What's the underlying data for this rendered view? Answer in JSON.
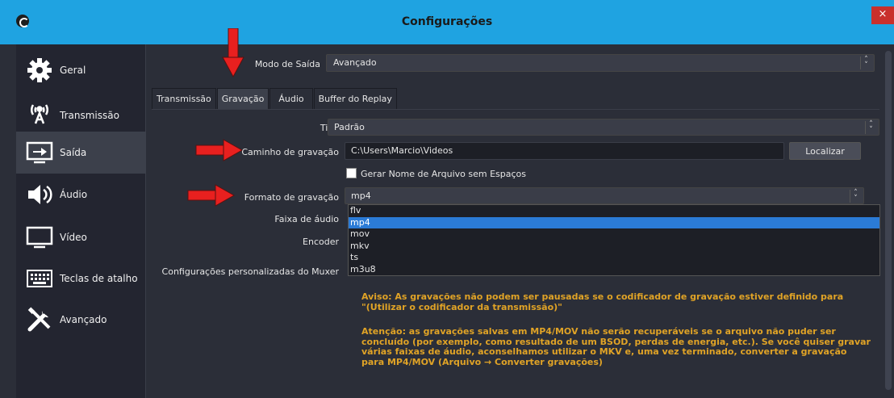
{
  "window": {
    "title": "Configurações",
    "close_label": "×"
  },
  "sidebar": {
    "items": [
      {
        "label": "Geral",
        "icon": "gear-icon",
        "active": false
      },
      {
        "label": "Transmissão",
        "icon": "broadcast-icon",
        "active": false
      },
      {
        "label": "Saída",
        "icon": "output-monitor-icon",
        "active": true
      },
      {
        "label": "Áudio",
        "icon": "speaker-icon",
        "active": false
      },
      {
        "label": "Vídeo",
        "icon": "monitor-icon",
        "active": false
      },
      {
        "label": "Teclas de atalho",
        "icon": "keyboard-icon",
        "active": false
      },
      {
        "label": "Avançado",
        "icon": "tools-icon",
        "active": false
      }
    ]
  },
  "output_mode": {
    "label": "Modo de Saída",
    "value": "Avançado"
  },
  "tabs": [
    {
      "label": "Transmissão",
      "active": false
    },
    {
      "label": "Gravação",
      "active": true
    },
    {
      "label": "Áudio",
      "active": false
    },
    {
      "label": "Buffer do Replay",
      "active": false
    }
  ],
  "recording": {
    "type_label": "Tipo",
    "type_value": "Padrão",
    "path_label": "Caminho de gravação",
    "path_value": "C:\\Users\\Marcio\\Videos",
    "browse_label": "Localizar",
    "nospace_label": "Gerar Nome de Arquivo sem Espaços",
    "format_label": "Formato de gravação",
    "format_value": "mp4",
    "format_options": [
      "flv",
      "mp4",
      "mov",
      "mkv",
      "ts",
      "m3u8"
    ],
    "format_selected": "mp4",
    "audio_track_label": "Faixa de áudio",
    "encoder_label": "Encoder",
    "muxer_label": "Configurações personalizadas do Muxer",
    "warning1": [
      "Aviso: As gravações não podem ser pausadas se o codificador de gravação estiver definido para",
      "\"(Utilizar o codificador da transmissão)\""
    ],
    "warning2": [
      "Atenção: as gravações salvas em MP4/MOV não serão recuperáveis se o arquivo não puder ser",
      "concluído (por exemplo, como resultado de um BSOD, perdas de energia, etc.). Se você quiser gravar",
      "várias faixas de áudio, aconselhamos utilizar o MKV e, uma vez terminado, converter a gravação",
      "para MP4/MOV (Arquivo → Converter gravações)"
    ]
  },
  "colors": {
    "titlebar": "#1fa3e1",
    "accent_selected": "#2b7bd6",
    "warning": "#e0a326",
    "annotation_arrow": "#e8201f"
  }
}
